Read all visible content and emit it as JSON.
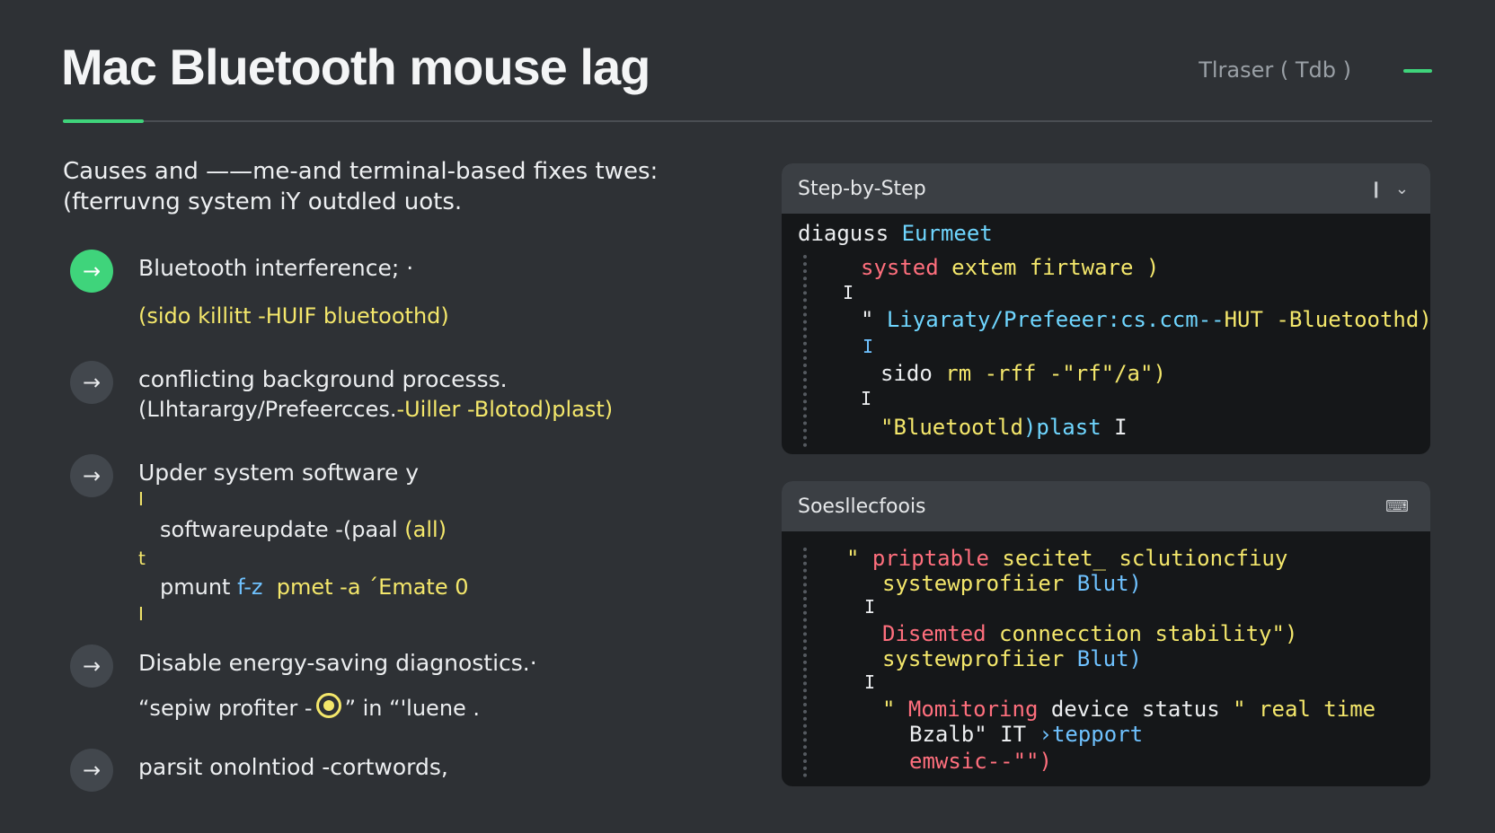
{
  "header": {
    "title": "Mac Bluetooth mouse lag",
    "right_label": "Tlraser ( Tdb )"
  },
  "intro": {
    "line1": "Causes and ——me-and terminal-based fixes twes:",
    "line2": "(fterruvng system iY outdled uots."
  },
  "steps": [
    {
      "icon": "arrow-right-icon",
      "text": "Bluetooth interference; ·",
      "code": [
        {
          "text": "(sido killitt -HUIF bluetoothd)"
        }
      ]
    },
    {
      "icon": "arrow-right-icon",
      "text": "conflicting background processs.",
      "code": [
        {
          "text_a": "(LIhtarargy/Prefeercces.",
          "text_b": "-Uiller -Blotod)plast)"
        }
      ]
    },
    {
      "icon": "arrow-right-icon",
      "text": "Upder system software y",
      "code": [
        {
          "marker": "I"
        },
        {
          "text_a": "softwareupdate -(paal",
          "text_b": "(all)"
        },
        {
          "marker": "t"
        },
        {
          "text_a": "pmunt",
          "text_b": "f-z",
          "text_c": "pmet -a ´Emate 0"
        },
        {
          "marker": "I"
        }
      ]
    },
    {
      "icon": "arrow-right-icon",
      "text": "Disable energy-saving diagnostics.·",
      "code": [
        {
          "text_a": "“sepiw profiter -",
          "text_b": "” in “'luene ."
        }
      ]
    },
    {
      "icon": "arrow-right-icon",
      "text": "parsit onolntiod -cortwords,"
    }
  ],
  "panel1": {
    "title": "Step-by-Step",
    "icons": [
      "pause-icon",
      "collapse-icon"
    ],
    "lines": [
      {
        "a": "diaguss",
        "b": "Eurmeet"
      },
      {
        "a": "systed",
        "b": "extem",
        "c": "firtware )"
      },
      {
        "a": "I"
      },
      {
        "a": "\"",
        "b": "Liyaraty/Prefeeer:cs.ccm--",
        "c": "HUT -Bluetoothd)"
      },
      {
        "a": "I"
      },
      {
        "a": "sido",
        "b": "rm -rff -\"rf\"/a\")"
      },
      {
        "a": "I"
      },
      {
        "a": "\"Bluetootld",
        "b": ")plast",
        "c": "I"
      }
    ]
  },
  "panel2": {
    "title": "Soesllecfoois",
    "icons": [
      "terminal-icon"
    ],
    "lines": [
      {
        "a": "\"",
        "b": "priptable",
        "c": "secitet_ sclutioncfiuy"
      },
      {
        "a": "systewprofiier",
        "b": "Blut)"
      },
      {
        "a": "I"
      },
      {
        "a": "Disemted",
        "b": "connecction",
        "c": "stability\")"
      },
      {
        "a": "systewprofiier",
        "b": "Blut)"
      },
      {
        "a": "I"
      },
      {
        "a": "\"",
        "b": "Momitoring",
        "c": "device status",
        "d": "\" real time"
      },
      {
        "a": "Bzalb\" IT",
        "b": "›tepport"
      },
      {
        "a": "emwsic--\"\")"
      }
    ]
  },
  "colors": {
    "accent": "#3fd47b",
    "background": "#2e3135",
    "code_yellow": "#f4e76b",
    "code_blue": "#6fc2ff",
    "code_red": "#ff6f7d"
  }
}
